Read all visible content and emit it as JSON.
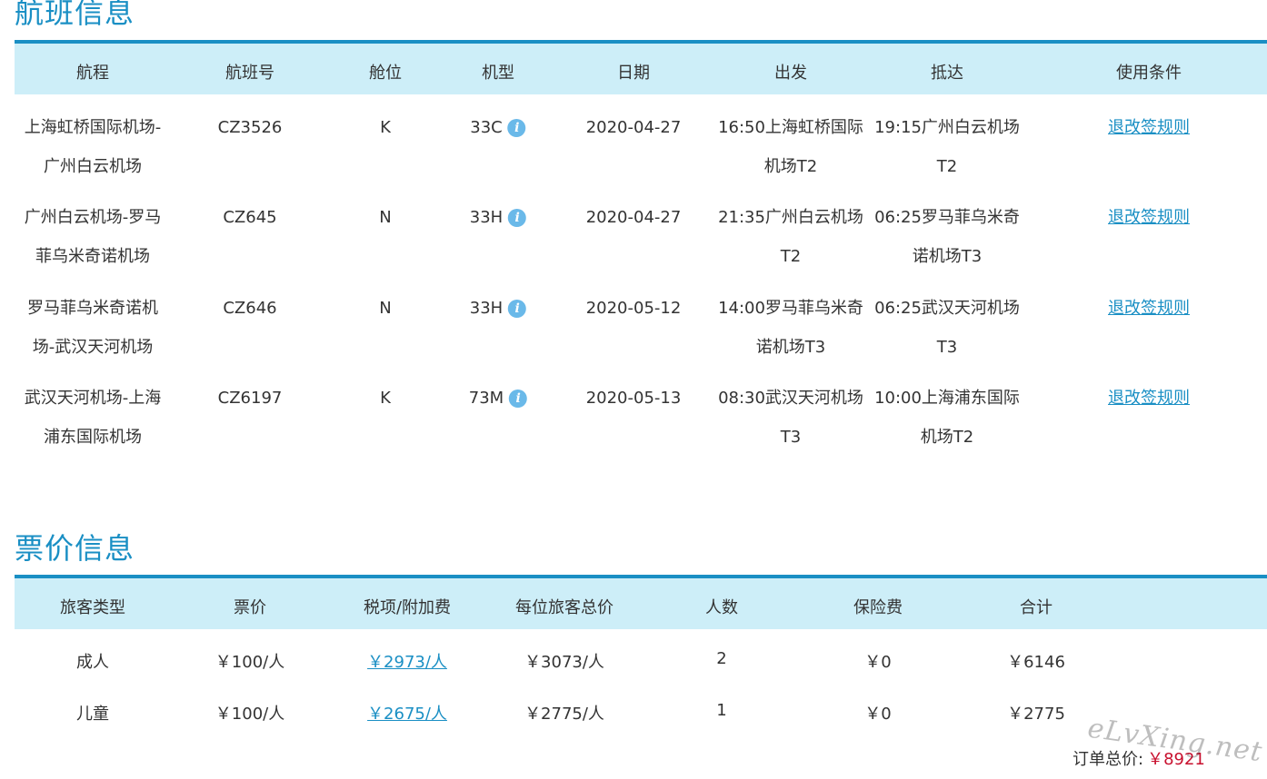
{
  "flight_section": {
    "title": "航班信息",
    "headers": [
      "航程",
      "航班号",
      "舱位",
      "机型",
      "日期",
      "出发",
      "抵达",
      "使用条件"
    ],
    "rows": [
      {
        "route": "上海虹桥国际机场-广州白云机场",
        "flight_no": "CZ3526",
        "cabin": "K",
        "aircraft": "33C",
        "date": "2020-04-27",
        "depart": "16:50上海虹桥国际机场T2",
        "arrive": "19:15广州白云机场T2",
        "rule": "退改签规则"
      },
      {
        "route": "广州白云机场-罗马菲乌米奇诺机场",
        "flight_no": "CZ645",
        "cabin": "N",
        "aircraft": "33H",
        "date": "2020-04-27",
        "depart": "21:35广州白云机场T2",
        "arrive": "06:25罗马菲乌米奇诺机场T3",
        "rule": "退改签规则"
      },
      {
        "route": "罗马菲乌米奇诺机场-武汉天河机场",
        "flight_no": "CZ646",
        "cabin": "N",
        "aircraft": "33H",
        "date": "2020-05-12",
        "depart": "14:00罗马菲乌米奇诺机场T3",
        "arrive": "06:25武汉天河机场T3",
        "rule": "退改签规则"
      },
      {
        "route": "武汉天河机场-上海浦东国际机场",
        "flight_no": "CZ6197",
        "cabin": "K",
        "aircraft": "73M",
        "date": "2020-05-13",
        "depart": "08:30武汉天河机场T3",
        "arrive": "10:00上海浦东国际机场T2",
        "rule": "退改签规则"
      }
    ]
  },
  "price_section": {
    "title": "票价信息",
    "headers": [
      "旅客类型",
      "票价",
      "税项/附加费",
      "每位旅客总价",
      "人数",
      "保险费",
      "合计"
    ],
    "rows": [
      {
        "type": "成人",
        "fare": "￥100/人",
        "tax": "￥2973/人",
        "per_total": "￥3073/人",
        "count": "2",
        "insurance": "￥0",
        "subtotal": "￥6146"
      },
      {
        "type": "儿童",
        "fare": "￥100/人",
        "tax": "￥2675/人",
        "per_total": "￥2775/人",
        "count": "1",
        "insurance": "￥0",
        "subtotal": "￥2775"
      }
    ],
    "total_label": "订单总价:",
    "total_value": "￥8921"
  },
  "watermark": "eLvXing.net",
  "icons": {
    "aircraft_info": "info-icon"
  },
  "colors": {
    "accent": "#1a8fc4",
    "header_bg": "#cdeef8",
    "total": "#c8102e"
  }
}
